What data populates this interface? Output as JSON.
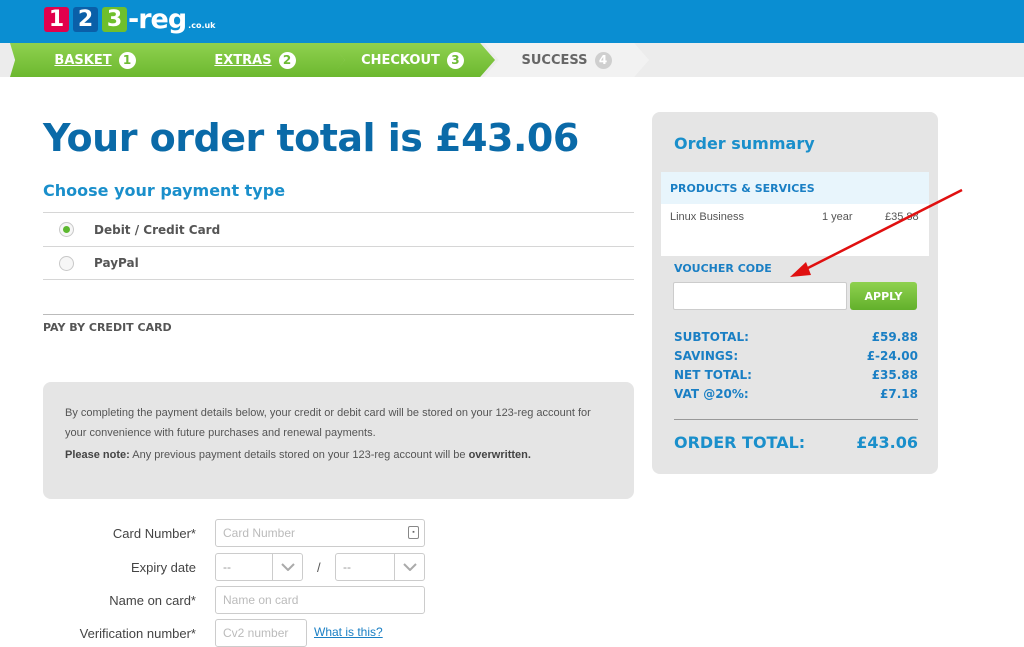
{
  "header": {
    "logo": {
      "d1": "1",
      "d2": "2",
      "d3": "3",
      "word": "-reg",
      "tld": ".co.uk"
    }
  },
  "steps": [
    {
      "label": "BASKET",
      "num": "1"
    },
    {
      "label": "EXTRAS",
      "num": "2"
    },
    {
      "label": "CHECKOUT",
      "num": "3"
    },
    {
      "label": "SUCCESS",
      "num": "4"
    }
  ],
  "main": {
    "title": "Your order total is £43.06",
    "payment_heading": "Choose your payment type",
    "payment_options": [
      {
        "label": "Debit / Credit Card",
        "selected": true
      },
      {
        "label": "PayPal",
        "selected": false
      }
    ],
    "pay_by_label": "PAY BY CREDIT CARD",
    "notice": {
      "text1": "By completing the payment details below, your credit or debit card will be stored on your 123-reg account for your convenience with future purchases and renewal payments.",
      "note_bold": "Please note:",
      "note_text": " Any previous payment details stored on your 123-reg account will be ",
      "note_end": "overwritten."
    },
    "form": {
      "card_number_label": "Card Number*",
      "card_number_placeholder": "Card Number",
      "expiry_label": "Expiry date",
      "expiry_month": "--",
      "expiry_sep": "/",
      "expiry_year": "--",
      "name_label": "Name on card*",
      "name_placeholder": "Name on card",
      "cvv_label": "Verification number*",
      "cvv_placeholder": "Cv2 number",
      "what_link": "What is this?"
    }
  },
  "summary": {
    "title": "Order summary",
    "products_heading": "PRODUCTS & SERVICES",
    "product": {
      "name": "Linux Business",
      "term": "1 year",
      "price": "£35.88"
    },
    "voucher_label": "VOUCHER CODE",
    "voucher_value": "",
    "apply_label": "APPLY",
    "totals": [
      {
        "label": "SUBTOTAL:",
        "value": "£59.88"
      },
      {
        "label": "SAVINGS:",
        "value": "£-24.00"
      },
      {
        "label": "NET TOTAL:",
        "value": "£35.88"
      },
      {
        "label": "VAT @20%:",
        "value": "£7.18"
      }
    ],
    "order_total_label": "ORDER TOTAL:",
    "order_total_value": "£43.06"
  },
  "colors": {
    "brand_blue": "#0a8ed2",
    "accent_green": "#6cb82f",
    "heading_blue": "#0a6aa8",
    "annotation_red": "#e01010"
  }
}
